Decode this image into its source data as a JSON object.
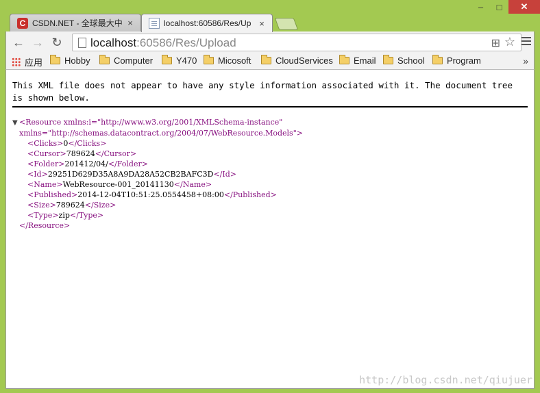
{
  "tabs": [
    {
      "title": "CSDN.NET - 全球最大中",
      "favicon": "csdn-icon",
      "close": "×"
    },
    {
      "title": "localhost:60586/Res/Up",
      "favicon": "document-icon",
      "close": "×"
    }
  ],
  "window_controls": {
    "minimize": "–",
    "maximize": "□",
    "close": "✕"
  },
  "toolbar": {
    "back": "←",
    "forward": "→",
    "reload": "↻",
    "url_host": "localhost",
    "url_rest": ":60586/Res/Upload",
    "translate_icon": "⊞",
    "star_icon": "☆"
  },
  "bookmarks": {
    "apps_label": "应用",
    "items": [
      "Hobby",
      "Computer",
      "Y470",
      "Micosoft",
      "CloudServices",
      "Email",
      "School",
      "Program"
    ],
    "overflow": "»"
  },
  "content": {
    "notice": "This XML file does not appear to have any style information associated with it. The document tree is shown below.",
    "xml": {
      "collapse_toggle": "▼",
      "root_open_1": "<Resource xmlns:i=\"http://www.w3.org/2001/XMLSchema-instance\"",
      "root_open_2": "xmlns=\"http://schemas.datacontract.org/2004/07/WebResource.Models\">",
      "elements": [
        {
          "tag": "Clicks",
          "value": "0"
        },
        {
          "tag": "Cursor",
          "value": "789624"
        },
        {
          "tag": "Folder",
          "value": "201412/04/"
        },
        {
          "tag": "Id",
          "value": "29251D629D35A8A9DA28A52CB2BAFC3D"
        },
        {
          "tag": "Name",
          "value": "WebResource-001_20141130"
        },
        {
          "tag": "Published",
          "value": "2014-12-04T10:51:25.0554458+08:00"
        },
        {
          "tag": "Size",
          "value": "789624"
        },
        {
          "tag": "Type",
          "value": "zip"
        }
      ],
      "root_close": "</Resource>"
    }
  },
  "watermark": "http://blog.csdn.net/qiujuer",
  "colors": {
    "frame": "#a3c951",
    "tag": "#881280",
    "attr": "#994500",
    "value": "#1a1aa6"
  }
}
